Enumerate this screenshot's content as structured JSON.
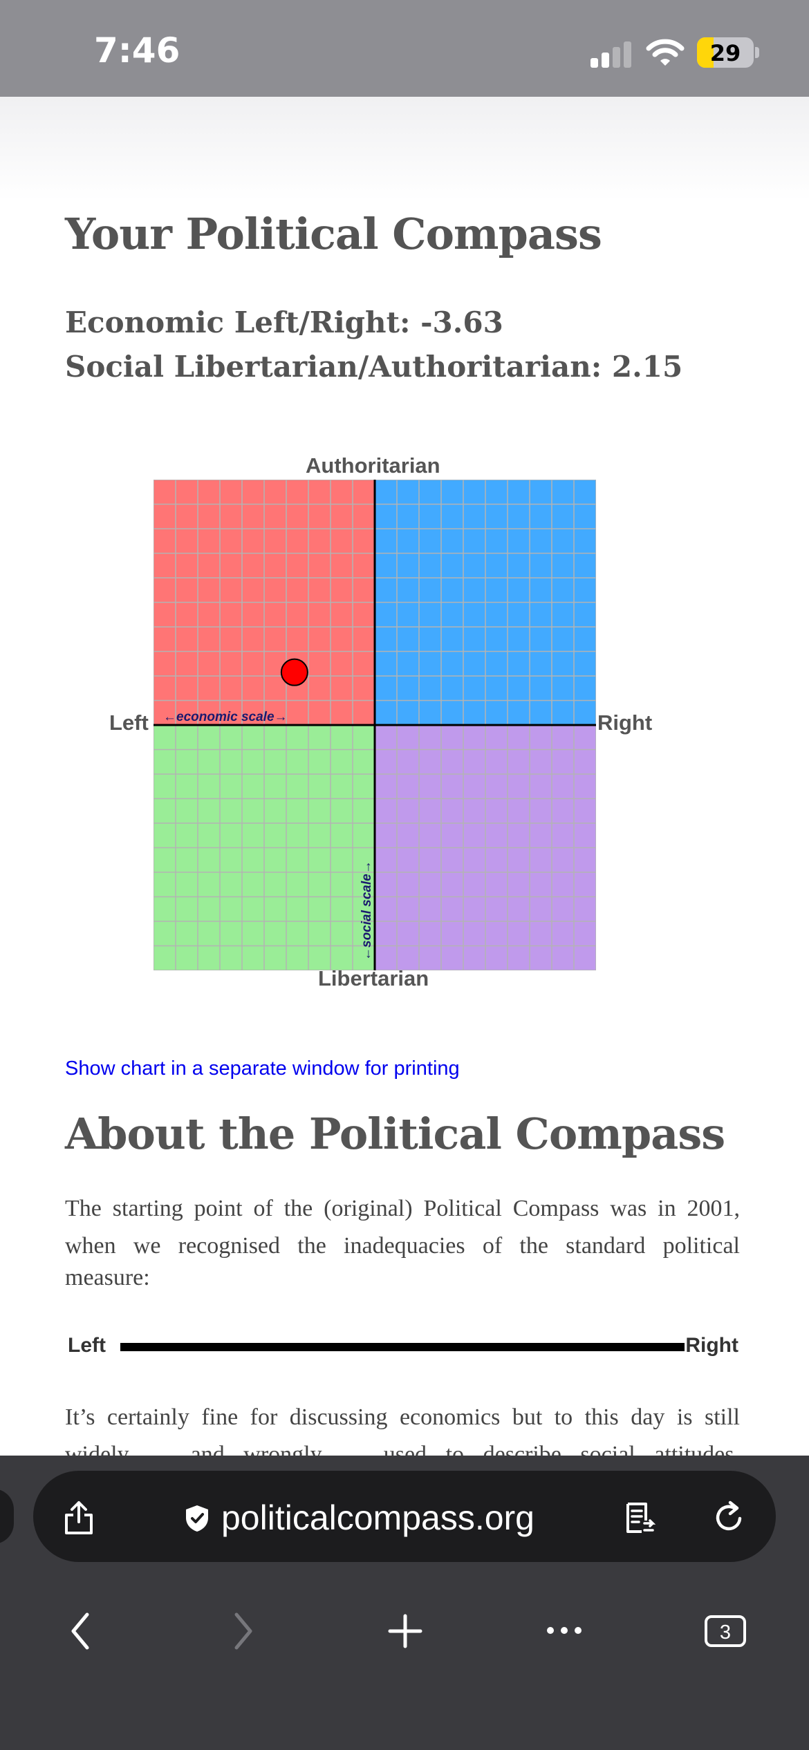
{
  "status_bar": {
    "time": "7:46",
    "battery_percent": 29,
    "battery_label": "29",
    "signal_bars_active": 2,
    "signal_bars_total": 4,
    "battery_color": "#ffd60a"
  },
  "page": {
    "title": "Your Political Compass",
    "economic_score_line": "Economic Left/Right: -3.63",
    "social_score_line": "Social Libertarian/Authoritarian: 2.15"
  },
  "chart_data": {
    "type": "scatter",
    "title": "",
    "labels": {
      "top": "Authoritarian",
      "bottom": "Libertarian",
      "left": "Left",
      "right": "Right"
    },
    "economic_axis_caption": "←economic scale→",
    "social_axis_caption": "←social scale→",
    "xlim": [
      -10,
      10
    ],
    "ylim": [
      -10,
      10
    ],
    "grid": true,
    "grid_divisions": 20,
    "quadrant_colors": {
      "authoritarian_left": "#ff7575",
      "authoritarian_right": "#42aaff",
      "libertarian_left": "#9aed97",
      "libertarian_right": "#c09aec"
    },
    "grid_color": "#b3b3b3",
    "point": {
      "x": -3.63,
      "y": 2.15,
      "color": "#ff0000"
    }
  },
  "links": {
    "print_chart": "Show chart in a separate window for printing"
  },
  "about": {
    "title": "About the Political Compass",
    "para1_main": "The starting point of the (original) Political Compass was in 2001, when we recognised the inadequacies of the standard political",
    "para1_end": "measure:",
    "scale_left": "Left",
    "scale_right": "Right",
    "para2_line1": "It’s certainly fine for discussing economics but to this day is still",
    "para2_line2": "widely — and wrongly — used to describe social attitudes,"
  },
  "browser": {
    "url": "politicalcompass.org",
    "tab_count": "3",
    "icons": [
      "share-icon",
      "shield-icon",
      "reader-mode-icon",
      "reload-icon",
      "back-icon",
      "forward-icon",
      "new-tab-icon",
      "more-icon",
      "tabs-icon"
    ]
  }
}
